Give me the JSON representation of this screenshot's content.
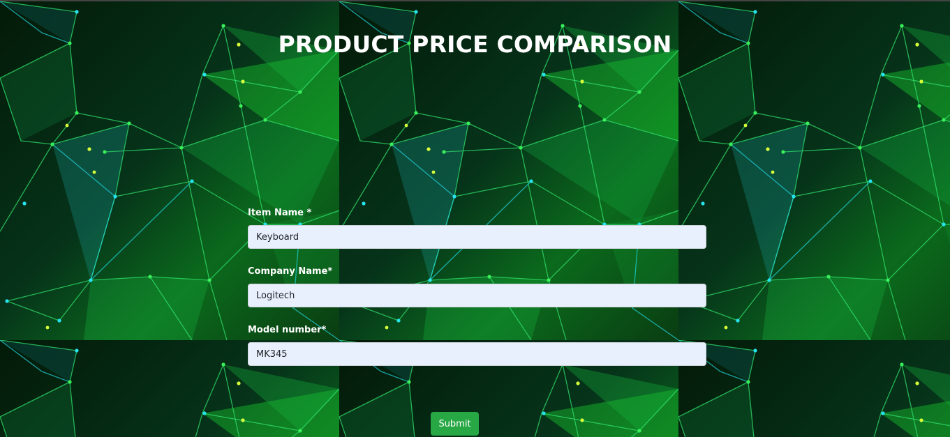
{
  "title": "PRODUCT PRICE COMPARISON",
  "form": {
    "fields": [
      {
        "label": "Item Name *",
        "value": "Keyboard"
      },
      {
        "label": "Company Name*",
        "value": "Logitech"
      },
      {
        "label": "Model number*",
        "value": "MK345"
      }
    ],
    "submit_label": "Submit"
  },
  "colors": {
    "background": "#000000",
    "network_green": "#2bd84a",
    "network_cyan": "#1fd6e0",
    "input_fill": "#e8f0fe",
    "submit": "#28a745",
    "title_text": "#ffffff"
  }
}
